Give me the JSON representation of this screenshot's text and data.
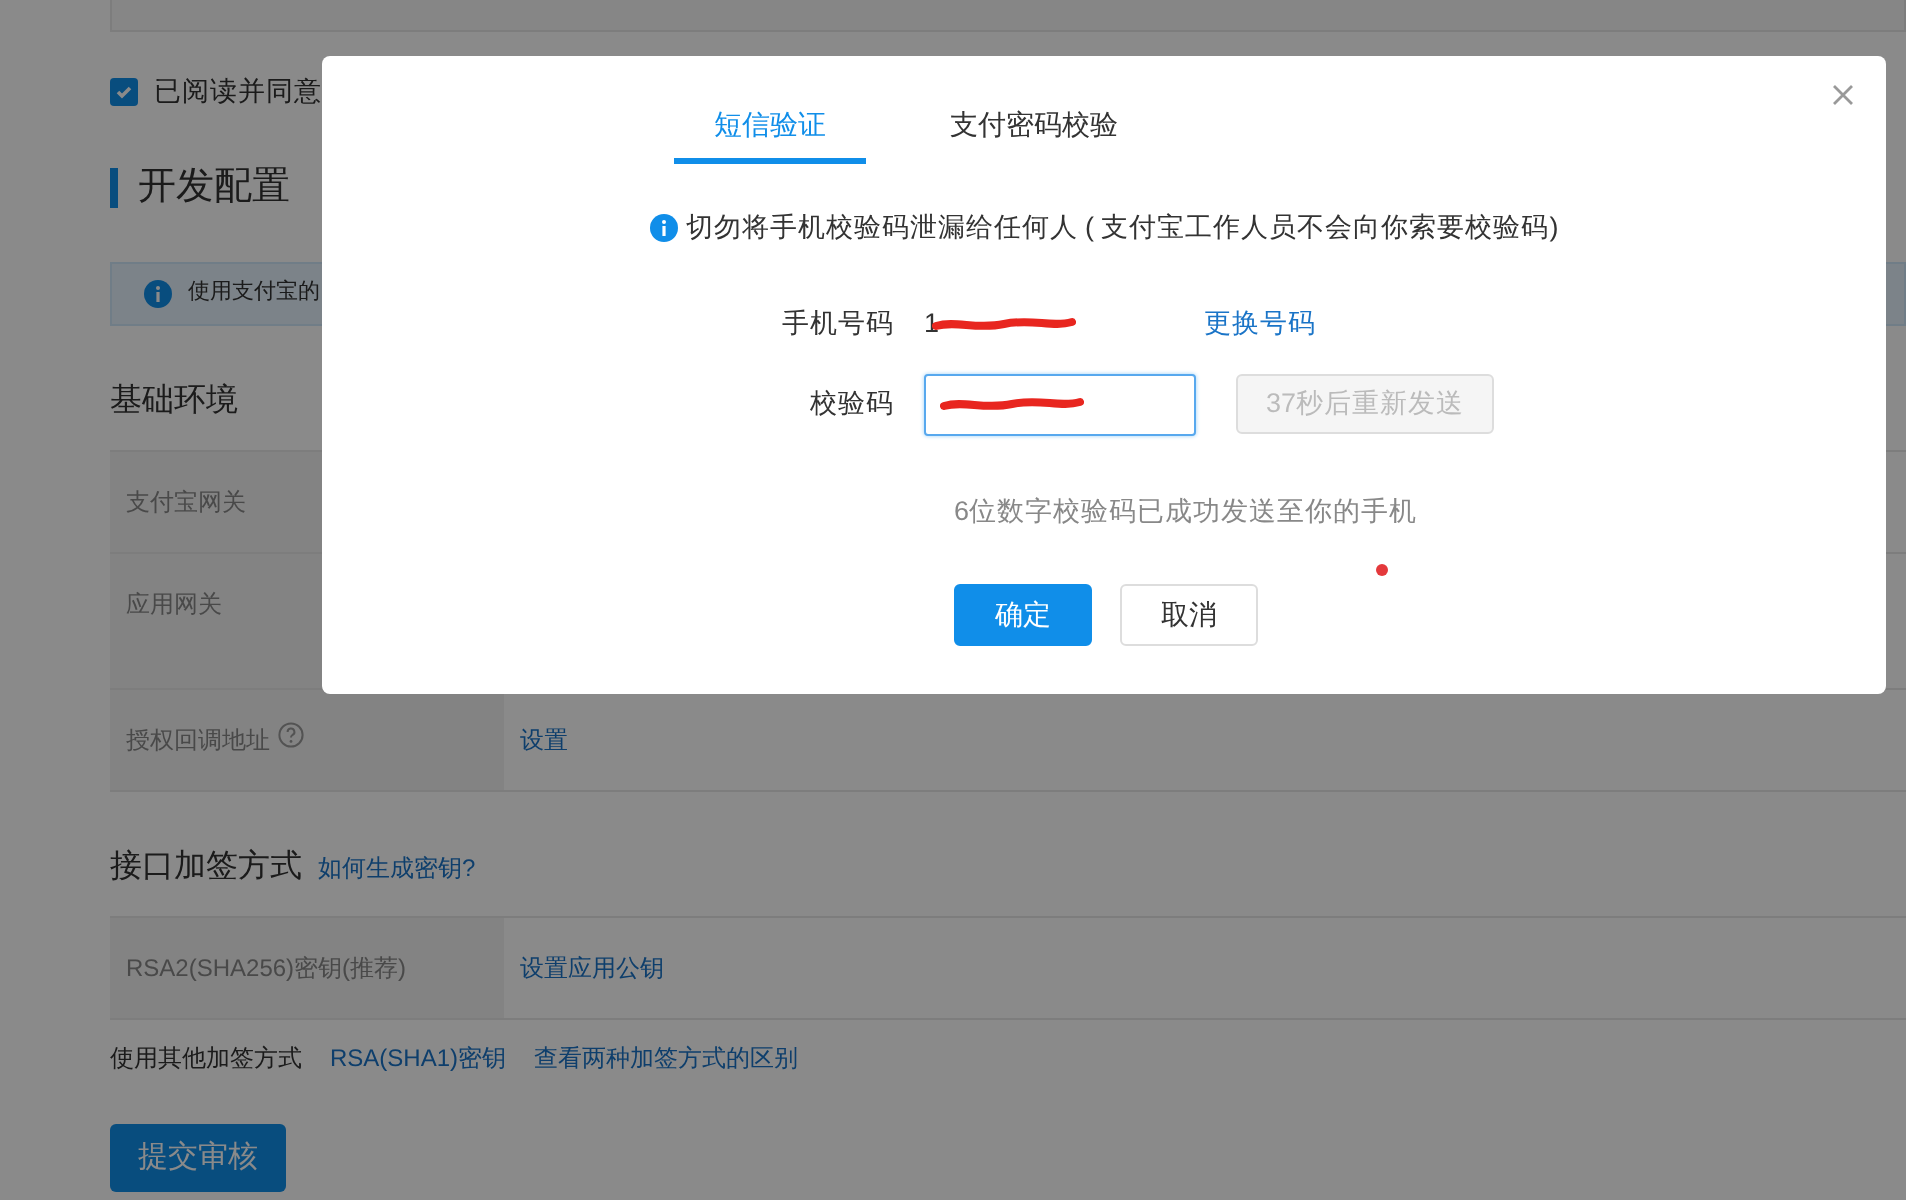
{
  "background_page": {
    "agreement": {
      "label": "已阅读并同意",
      "checked": true
    },
    "section_title": "开发配置",
    "notice": "使用支付宝的",
    "basic_env": {
      "title": "基础环境",
      "rows": [
        {
          "label": "支付宝网关"
        },
        {
          "label": "应用网关"
        },
        {
          "label": "授权回调地址",
          "help": true,
          "action": "设置"
        }
      ]
    },
    "signing": {
      "title": "接口加签方式",
      "help_link": "如何生成密钥?",
      "rows": [
        {
          "label": "RSA2(SHA256)密钥(推荐)",
          "action": "设置应用公钥"
        }
      ],
      "other_label": "使用其他加签方式",
      "other_links": [
        "RSA(SHA1)密钥",
        "查看两种加签方式的区别"
      ]
    },
    "submit": "提交审核"
  },
  "dialog": {
    "tabs": [
      {
        "label": "短信验证",
        "selected": true
      },
      {
        "label": "支付密码校验",
        "selected": false
      }
    ],
    "notice": "切勿将手机校验码泄漏给任何人 ( 支付宝工作人员不会向你索要校验码)",
    "fields": [
      {
        "kind": "text",
        "label": "手机号码",
        "value": "1",
        "redacted": true,
        "link": "更换号码"
      },
      {
        "kind": "input",
        "label": "校验码",
        "redacted": true,
        "button": "37秒后重新发送",
        "button_disabled": true
      }
    ],
    "hint": "6位数字校验码已成功发送至你的手机",
    "buttons": [
      {
        "label": "确定",
        "kind": "primary"
      },
      {
        "label": "取消",
        "kind": "default"
      }
    ]
  }
}
